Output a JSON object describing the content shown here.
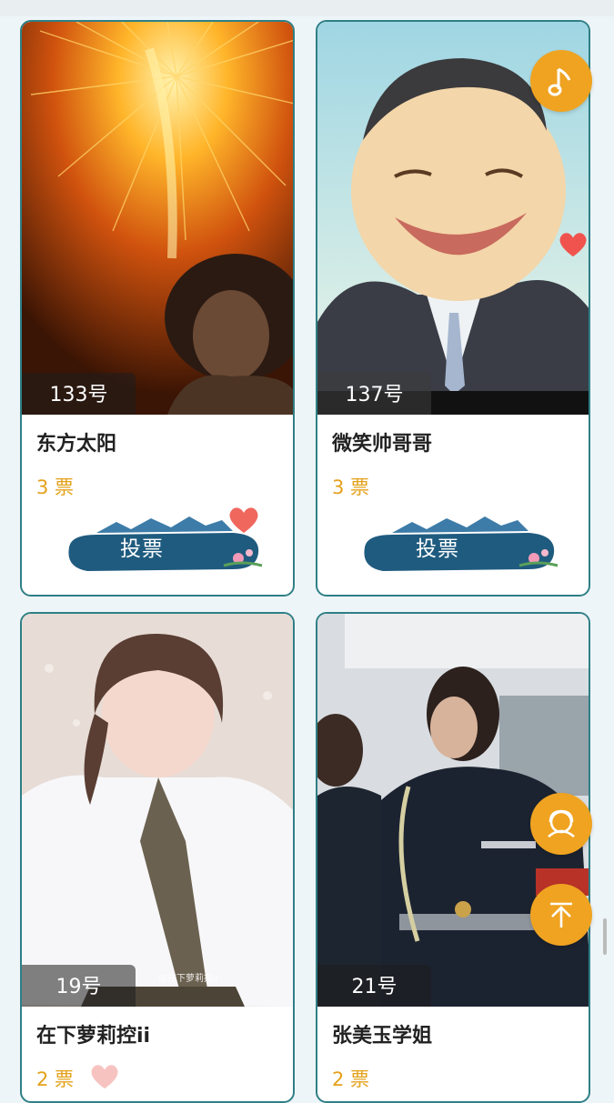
{
  "contestants": [
    {
      "number": "133号",
      "name": "东方太阳",
      "votes": "3 票",
      "vote_label": "投票"
    },
    {
      "number": "137号",
      "name": "微笑帅哥哥",
      "votes": "3 票",
      "vote_label": "投票"
    },
    {
      "number": "19号",
      "name": "在下萝莉控ii",
      "votes": "2 票"
    },
    {
      "number": "21号",
      "name": "张美玉学姐",
      "votes": "2 票"
    }
  ],
  "watermark": "@在下萝莉控ii",
  "colors": {
    "accent": "#efa321",
    "border": "#2f7f86",
    "vote_text": "#e4a11a",
    "heart": "#f0534d"
  },
  "icons": {
    "music": "music-note-icon",
    "service": "customer-service-icon",
    "top": "back-to-top-icon",
    "heart": "heart-icon"
  }
}
